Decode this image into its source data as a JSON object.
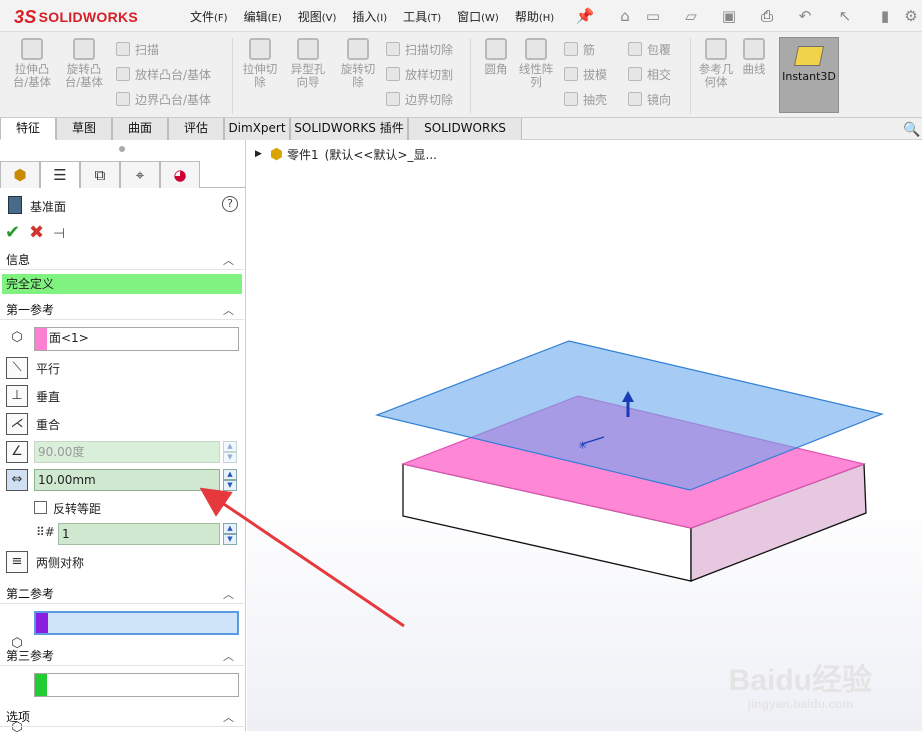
{
  "app": {
    "logo_prefix": "3S",
    "logo_text": "SOLIDWORKS"
  },
  "menus": [
    {
      "label": "文件",
      "key": "(F)"
    },
    {
      "label": "编辑",
      "key": "(E)"
    },
    {
      "label": "视图",
      "key": "(V)"
    },
    {
      "label": "插入",
      "key": "(I)"
    },
    {
      "label": "工具",
      "key": "(T)"
    },
    {
      "label": "窗口",
      "key": "(W)"
    },
    {
      "label": "帮助",
      "key": "(H)"
    }
  ],
  "ribbon": {
    "extrude_boss": "拉伸凸\n台/基体",
    "revolve_boss": "旋转凸\n台/基体",
    "sweep": "扫描",
    "loft": "放样凸台/基体",
    "boundary": "边界凸台/基体",
    "extrude_cut": "拉伸切\n除",
    "hole_wizard": "异型孔\n向导",
    "revolve_cut": "旋转切\n除",
    "sweep_cut": "扫描切除",
    "loft_cut": "放样切割",
    "boundary_cut": "边界切除",
    "fillet": "圆角",
    "linear_pattern": "线性阵\n列",
    "rib": "筋",
    "draft": "拔模",
    "shell": "抽壳",
    "wrap": "包覆",
    "intersect": "相交",
    "mirror": "镜向",
    "ref_geometry": "参考几\n何体",
    "curves": "曲线",
    "instant3d": "Instant3D"
  },
  "tabs": [
    "特征",
    "草图",
    "曲面",
    "评估",
    "DimXpert",
    "SOLIDWORKS 插件",
    "SOLIDWORKS MBD"
  ],
  "panel": {
    "title": "基准面",
    "info_header": "信息",
    "status": "完全定义",
    "first_ref": {
      "header": "第一参考",
      "selection": "面<1>",
      "parallel": "平行",
      "perpendicular": "垂直",
      "coincident": "重合",
      "angle": "90.00度",
      "distance": "10.00mm",
      "flip_offset": "反转等距",
      "count": "1",
      "mid_plane": "两侧对称"
    },
    "second_ref": {
      "header": "第二参考"
    },
    "third_ref": {
      "header": "第三参考"
    },
    "options_header": "选项"
  },
  "tree": {
    "part_name": "零件1",
    "config": "(默认<<默认>_显..."
  },
  "colors": {
    "status_green": "#7ff27f",
    "face_pink": "#ff88d6",
    "plane_blue": "#8fc4f4",
    "ref1": "#ff7fd0",
    "ref2": "#8a1fe0",
    "ref3": "#22cc33",
    "arrow": "#e5393d"
  },
  "watermark": {
    "brand": "Baidu经验",
    "url": "jingyan.baidu.com"
  }
}
